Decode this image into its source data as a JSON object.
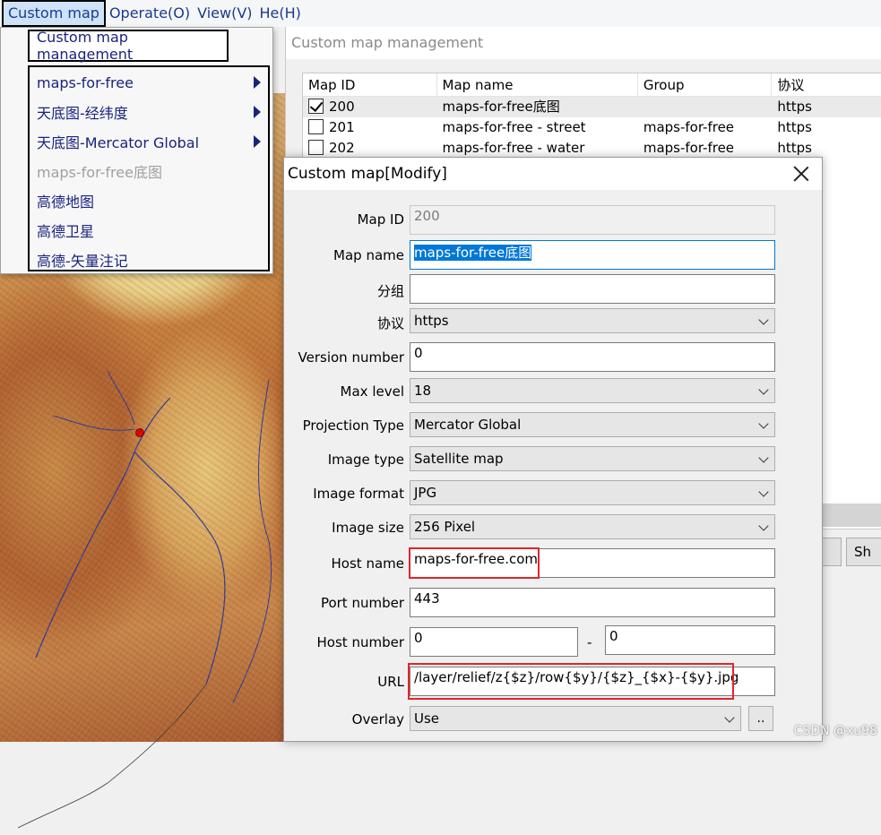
{
  "menubar": {
    "items": [
      "Custom map",
      "Operate(O)",
      "View(V)",
      "He",
      "(H)"
    ]
  },
  "dropdown": {
    "top_item": "Custom map management",
    "items": [
      {
        "label": "maps-for-free",
        "submenu": true,
        "disabled": false
      },
      {
        "label": "天底图-经纬度",
        "submenu": true,
        "disabled": false
      },
      {
        "label": "天底图-Mercator Global",
        "submenu": true,
        "disabled": false
      },
      {
        "label": "maps-for-free底图",
        "submenu": false,
        "disabled": true
      },
      {
        "label": "高德地图",
        "submenu": false,
        "disabled": false
      },
      {
        "label": "高德卫星",
        "submenu": false,
        "disabled": false
      },
      {
        "label": "高德-矢量注记",
        "submenu": false,
        "disabled": false
      }
    ]
  },
  "management": {
    "title": "Custom map management",
    "columns": [
      "Map ID",
      "Map name",
      "Group",
      "协议"
    ],
    "rows": [
      {
        "id": "200",
        "name": "maps-for-free底图",
        "group": "",
        "protocol": "https",
        "checked": true
      },
      {
        "id": "201",
        "name": "maps-for-free - street",
        "group": "maps-for-free",
        "protocol": "https",
        "checked": false
      },
      {
        "id": "202",
        "name": "maps-for-free - water",
        "group": "maps-for-free",
        "protocol": "https",
        "checked": false
      }
    ],
    "button_partial": "Sh"
  },
  "dialog": {
    "title": "Custom map[Modify]",
    "fields": {
      "map_id": {
        "label": "Map ID",
        "value": "200"
      },
      "map_name": {
        "label": "Map name",
        "value": "maps-for-free底图"
      },
      "group": {
        "label": "分组",
        "value": ""
      },
      "protocol": {
        "label": "协议",
        "value": "https"
      },
      "version": {
        "label": "Version number",
        "value": "0"
      },
      "max_level": {
        "label": "Max level",
        "value": "18"
      },
      "projection": {
        "label": "Projection Type",
        "value": "Mercator Global"
      },
      "image_type": {
        "label": "Image type",
        "value": "Satellite map"
      },
      "image_format": {
        "label": "Image format",
        "value": "JPG"
      },
      "image_size": {
        "label": "Image size",
        "value": "256 Pixel"
      },
      "host_name": {
        "label": "Host name",
        "value": "maps-for-free.com"
      },
      "port": {
        "label": "Port number",
        "value": "443"
      },
      "host_number": {
        "label": "Host number",
        "from": "0",
        "separator": "-",
        "to": "0"
      },
      "url": {
        "label": "URL",
        "value": "/layer/relief/z{$z}/row{$y}/{$z}_{$x}-{$y}.jpg"
      },
      "overlay": {
        "label": "Overlay",
        "value": "Use",
        "button": ".."
      }
    }
  },
  "watermark": "CSDN @xu98",
  "colors": {
    "accent": "#0078d7",
    "highlight_red": "#e0262b",
    "menu_text": "#1a237e"
  }
}
